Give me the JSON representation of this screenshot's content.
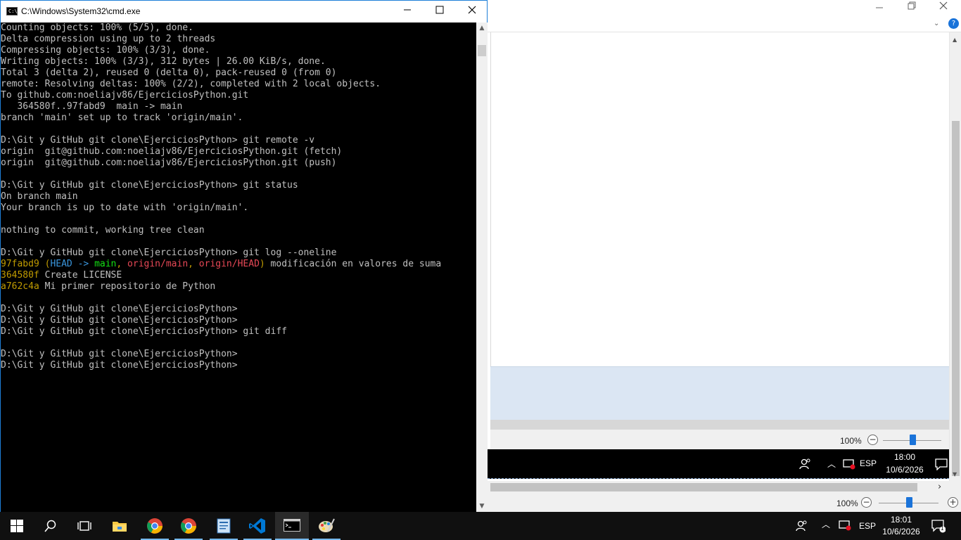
{
  "cmd": {
    "title": "C:\\Windows\\System32\\cmd.exe",
    "icon_label": "C:\\",
    "lines": [
      [
        {
          "t": "Counting objects: 100% (5/5), done.",
          "c": "gray"
        }
      ],
      [
        {
          "t": "Delta compression using up to 2 threads",
          "c": "gray"
        }
      ],
      [
        {
          "t": "Compressing objects: 100% (3/3), done.",
          "c": "gray"
        }
      ],
      [
        {
          "t": "Writing objects: 100% (3/3), 312 bytes | 26.00 KiB/s, done.",
          "c": "gray"
        }
      ],
      [
        {
          "t": "Total 3 (delta 2), reused 0 (delta 0), pack-reused 0 (from 0)",
          "c": "gray"
        }
      ],
      [
        {
          "t": "remote: Resolving deltas: 100% (2/2), completed with 2 local objects.",
          "c": "gray"
        }
      ],
      [
        {
          "t": "To github.com:noeliajv86/EjerciciosPython.git",
          "c": "gray"
        }
      ],
      [
        {
          "t": "   364580f..97fabd9  main -> main",
          "c": "gray"
        }
      ],
      [
        {
          "t": "branch 'main' set up to track 'origin/main'.",
          "c": "gray"
        }
      ],
      [],
      [
        {
          "t": "D:\\Git y GitHub git clone\\EjerciciosPython> git remote -v",
          "c": "gray"
        }
      ],
      [
        {
          "t": "origin  git@github.com:noeliajv86/EjerciciosPython.git (fetch)",
          "c": "gray"
        }
      ],
      [
        {
          "t": "origin  git@github.com:noeliajv86/EjerciciosPython.git (push)",
          "c": "gray"
        }
      ],
      [],
      [
        {
          "t": "D:\\Git y GitHub git clone\\EjerciciosPython> git status",
          "c": "gray"
        }
      ],
      [
        {
          "t": "On branch main",
          "c": "gray"
        }
      ],
      [
        {
          "t": "Your branch is up to date with 'origin/main'.",
          "c": "gray"
        }
      ],
      [],
      [
        {
          "t": "nothing to commit, working tree clean",
          "c": "gray"
        }
      ],
      [],
      [
        {
          "t": "D:\\Git y GitHub git clone\\EjerciciosPython> git log --oneline",
          "c": "gray"
        }
      ],
      [
        {
          "t": "97fabd9",
          "c": "yellow"
        },
        {
          "t": " (",
          "c": "yellow"
        },
        {
          "t": "HEAD -> ",
          "c": "cyan"
        },
        {
          "t": "main",
          "c": "green"
        },
        {
          "t": ", ",
          "c": "yellow"
        },
        {
          "t": "origin/main",
          "c": "red"
        },
        {
          "t": ", ",
          "c": "yellow"
        },
        {
          "t": "origin/HEAD",
          "c": "red"
        },
        {
          "t": ")",
          "c": "yellow"
        },
        {
          "t": " modificación en valores de suma",
          "c": "gray"
        }
      ],
      [
        {
          "t": "364580f",
          "c": "yellow"
        },
        {
          "t": " Create LICENSE",
          "c": "gray"
        }
      ],
      [
        {
          "t": "a762c4a",
          "c": "yellow"
        },
        {
          "t": " Mi primer repositorio de Python",
          "c": "gray"
        }
      ],
      [],
      [
        {
          "t": "D:\\Git y GitHub git clone\\EjerciciosPython>",
          "c": "gray"
        }
      ],
      [
        {
          "t": "D:\\Git y GitHub git clone\\EjerciciosPython>",
          "c": "gray"
        }
      ],
      [
        {
          "t": "D:\\Git y GitHub git clone\\EjerciciosPython> git diff",
          "c": "gray"
        }
      ],
      [],
      [
        {
          "t": "D:\\Git y GitHub git clone\\EjerciciosPython>",
          "c": "gray"
        }
      ],
      [
        {
          "t": "D:\\Git y GitHub git clone\\EjerciciosPython>",
          "c": "gray"
        }
      ]
    ]
  },
  "background_app": {
    "zoom_upper": "100%",
    "zoom_lower": "100%",
    "zoom_minus": "−",
    "zoom_plus": "+",
    "help_label": "?",
    "slider_level_percent": 50
  },
  "inner_tray": {
    "lang": "ESP",
    "time": "18:00",
    "date": "10/6/2026"
  },
  "tray": {
    "lang": "ESP",
    "time": "18:01",
    "date": "10/6/2026",
    "notification_count": "1"
  },
  "taskbar": {
    "items": [
      {
        "name": "start-button",
        "icon": "windows-icon"
      },
      {
        "name": "search-button",
        "icon": "search-icon"
      },
      {
        "name": "task-view-button",
        "icon": "task-view-icon"
      },
      {
        "name": "file-explorer-button",
        "icon": "folder-icon"
      },
      {
        "name": "chrome-button-1",
        "icon": "chrome-icon"
      },
      {
        "name": "chrome-button-2",
        "icon": "chrome-icon"
      },
      {
        "name": "notepad-app-button",
        "icon": "document-icon"
      },
      {
        "name": "vscode-button",
        "icon": "vscode-icon"
      },
      {
        "name": "cmd-button",
        "icon": "cmd-icon"
      },
      {
        "name": "paint-button",
        "icon": "paint-icon"
      }
    ]
  },
  "colors": {
    "console_yellow": "#c19c00",
    "console_cyan": "#3a96dd",
    "console_green": "#13e013",
    "console_red": "#e74856",
    "console_gray": "#c0c0c0",
    "window_border": "#1e7fd8"
  }
}
